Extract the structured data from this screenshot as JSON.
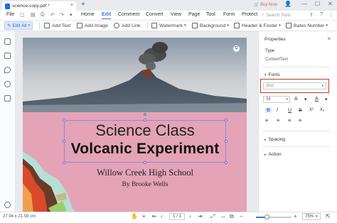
{
  "tab": {
    "title": "science-copy.pdf *",
    "close": "×",
    "new_tab": "+"
  },
  "window": {
    "buy_now": "Buy Now"
  },
  "menu": {
    "file": "File",
    "items": [
      "Home",
      "Edit",
      "Comment",
      "Convert",
      "View",
      "Page",
      "Tool",
      "Form",
      "Protect"
    ],
    "active": "Edit",
    "search_placeholder": "Search Tools"
  },
  "toolbar": {
    "edit_all": "Edit All",
    "add_text": "Add Text",
    "add_image": "Add Image",
    "add_link": "Add Link",
    "watermark": "Watermark",
    "background": "Background",
    "header_footer": "Header & Footer",
    "bates_number": "Bates Number"
  },
  "document": {
    "title_line1": "Science Class",
    "title_line2": "Volcanic Experiment",
    "school": "Willow Creek High School",
    "author": "By Brooke Wells"
  },
  "properties": {
    "header": "Properties",
    "type_label": "Type",
    "type_value": "ContentText",
    "fonts_label": "Fonts",
    "font_value": "Jost",
    "font_size": "36",
    "spacing_label": "Spacing",
    "action_label": "Action"
  },
  "status": {
    "dimensions": "27.94 x 21.59 cm",
    "page": "1 / 1",
    "zoom": "75%",
    "zoom_fraction": 0.3
  },
  "colors": {
    "accent": "#3a78d8",
    "pink_bg": "#e4a3b7",
    "highlight_border": "#c0392b"
  }
}
